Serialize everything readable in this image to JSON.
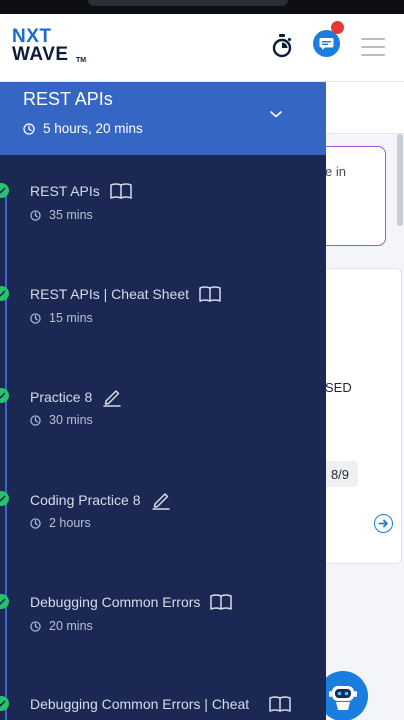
{
  "header": {
    "logo_line1": "NXT",
    "logo_line2": "WAVE",
    "logo_tm": "TM",
    "icons": [
      "stopwatch-icon",
      "chat-icon",
      "menu-icon"
    ],
    "notification_dot_color": "#e53935"
  },
  "drawer": {
    "title": "REST APIs",
    "duration": "5 hours, 20 mins",
    "items": [
      {
        "label": "REST APIs",
        "duration": "35 mins",
        "type_icon": "book-icon",
        "completed": true
      },
      {
        "label": "REST APIs | Cheat Sheet",
        "duration": "15 mins",
        "type_icon": "book-icon",
        "completed": true
      },
      {
        "label": "Practice 8",
        "duration": "30 mins",
        "type_icon": "pencil-icon",
        "completed": true
      },
      {
        "label": "Coding Practice 8",
        "duration": "2 hours",
        "type_icon": "pencil-icon",
        "completed": true
      },
      {
        "label": "Debugging Common Errors",
        "duration": "20 mins",
        "type_icon": "book-icon",
        "completed": true
      },
      {
        "label": "Debugging Common Errors | Cheat",
        "duration": "",
        "type_icon": "book-icon",
        "completed": true
      }
    ]
  },
  "background": {
    "partial_text_1": "e in",
    "partial_text_2": "SED",
    "counter": "8/9"
  },
  "colors": {
    "drawer_bg": "#1b2853",
    "drawer_header": "#3566c4",
    "check_green": "#27c26c",
    "accent_blue": "#1a7de0"
  }
}
